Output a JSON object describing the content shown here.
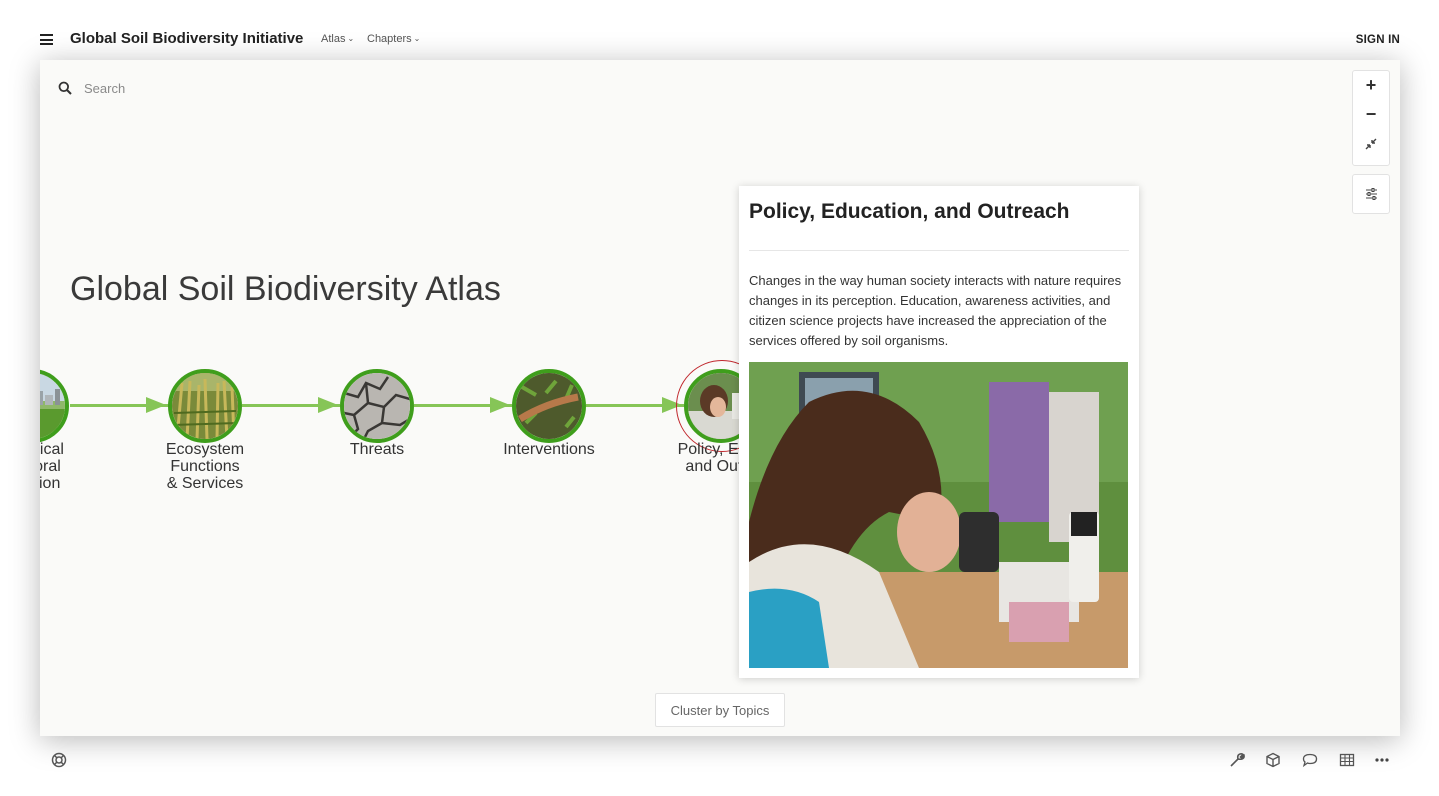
{
  "header": {
    "brand": "Global Soil Biodiversity Initiative",
    "menus": [
      {
        "label": "Atlas"
      },
      {
        "label": "Chapters"
      }
    ],
    "sign_in": "SIGN IN"
  },
  "search": {
    "placeholder": "Search"
  },
  "atlas": {
    "title": "Global Soil Biodiversity Atlas"
  },
  "nodes": [
    {
      "label": "phical\nporal\nution",
      "image": "city-skyline"
    },
    {
      "label": "Ecosystem\nFunctions\n& Services",
      "image": "crop-field"
    },
    {
      "label": "Threats",
      "image": "cracked-soil"
    },
    {
      "label": "Interventions",
      "image": "root-in-soil"
    },
    {
      "label": "Policy, Educ\nand Outre",
      "image": "girl-microscope"
    }
  ],
  "card": {
    "title": "Policy, Education, and Outreach",
    "body": "Changes in the way human society interacts with nature requires changes in its perception. Education, awareness activities, and citizen science projects have increased the appreciation of the services offered by soil organisms.",
    "image": "girl-looking-into-microscope"
  },
  "cluster_button": "Cluster by Topics",
  "colors": {
    "node_ring": "#3f9e1c",
    "arrow": "#86c557",
    "selected_ring": "#c0272d",
    "canvas_bg": "#fafaf8"
  }
}
